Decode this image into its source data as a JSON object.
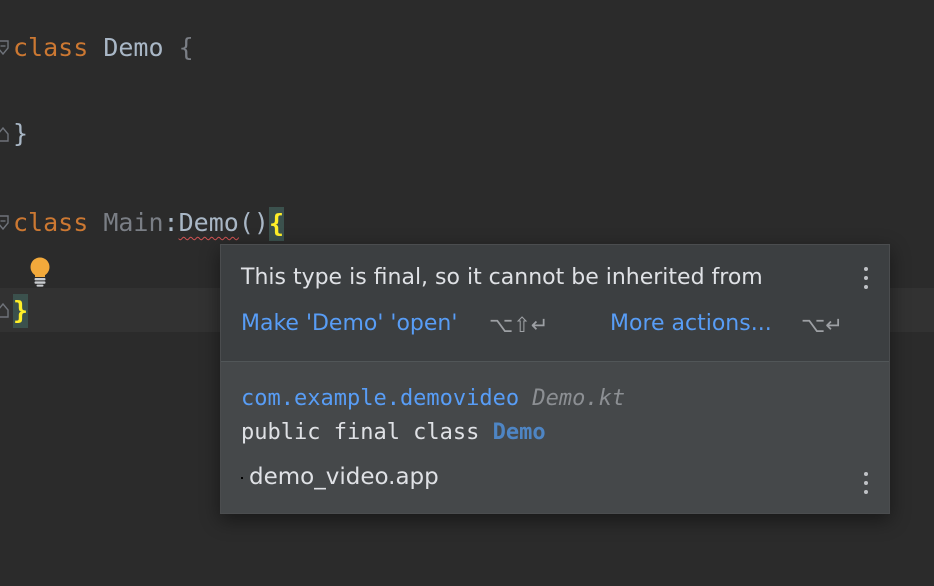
{
  "editor": {
    "lines": [
      {
        "keyword": "class",
        "name": "Demo",
        "open_brace": "{"
      },
      {
        "close_brace": "}"
      },
      {
        "keyword": "class",
        "name": "Main",
        "colon": ":",
        "supertype": "Demo",
        "parens": "()",
        "open_brace": "{"
      },
      {
        "close_brace": "}"
      }
    ]
  },
  "popup": {
    "message": "This type is final, so it cannot be inherited from",
    "primary_action": "Make 'Demo' 'open'",
    "primary_shortcut": "⌥⇧↵",
    "more_actions": "More actions...",
    "more_shortcut": "⌥↵",
    "package": "com.example.demovideo",
    "file": "Demo.kt",
    "declaration_prefix": "public final class",
    "declaration_name": "Demo",
    "module": "demo_video.app"
  },
  "colors": {
    "background": "#2b2b2b",
    "keyword": "#cc7832",
    "link": "#589df6",
    "error_underline": "#d25252",
    "brace_highlight": "#ffef28",
    "bulb": "#f2a93b"
  },
  "icons": [
    "fold-marker-icon",
    "intention-bulb-icon",
    "more-options-icon"
  ]
}
